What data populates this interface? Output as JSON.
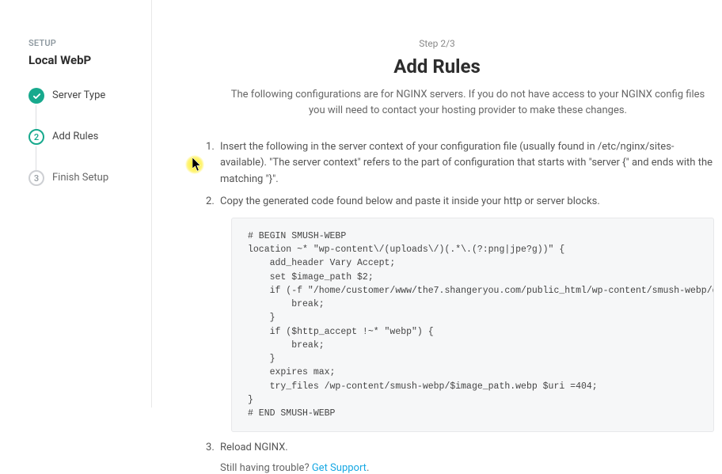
{
  "sidebar": {
    "setup_label": "SETUP",
    "product_title": "Local WebP",
    "steps": [
      {
        "label": "Server Type",
        "num": "1"
      },
      {
        "label": "Add Rules",
        "num": "2"
      },
      {
        "label": "Finish Setup",
        "num": "3"
      }
    ]
  },
  "header": {
    "step_counter": "Step 2/3",
    "title": "Add Rules",
    "description": "The following configurations are for NGINX servers. If you do not have access to your NGINX config files you will need to contact your hosting provider to make these changes."
  },
  "instructions": {
    "item1": "Insert the following in the server context of your configuration file (usually found in /etc/nginx/sites-available). \"The server context\" refers to the part of configuration that starts with \"server {\" and ends with the matching \"}\".",
    "item2": "Copy the generated code found below and paste it inside your http or server blocks.",
    "item3": "Reload NGINX."
  },
  "code": "# BEGIN SMUSH-WEBP\nlocation ~* \"wp-content\\/(uploads\\/)(.*\\.(?:png|jpe?g))\" {\n    add_header Vary Accept;\n    set $image_path $2;\n    if (-f \"/home/customer/www/the7.shangeryou.com/public_html/wp-content/smush-webp/disable_smush_webp\") {\n        break;\n    }\n    if ($http_accept !~* \"webp\") {\n        break;\n    }\n    expires max;\n    try_files /wp-content/smush-webp/$image_path.webp $uri =404;\n}\n# END SMUSH-WEBP",
  "trouble": {
    "text": "Still having trouble? ",
    "link_text": "Get Support",
    "link_suffix": "."
  }
}
